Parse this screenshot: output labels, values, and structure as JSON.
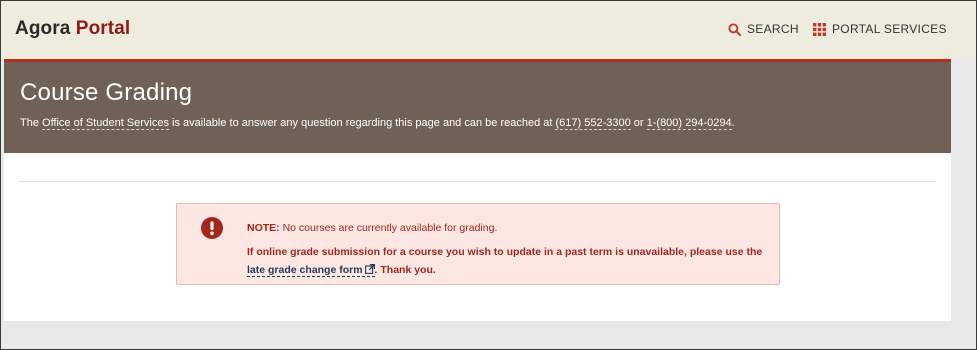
{
  "header": {
    "brand_first": "Agora",
    "brand_second": "Portal",
    "search_label": "SEARCH",
    "search_icon": "search-icon",
    "services_label": "PORTAL SERVICES",
    "services_icon": "grid-icon"
  },
  "banner": {
    "title": "Course Grading",
    "text_prefix": "The ",
    "office_link": "Office of Student Services",
    "text_middle": " is available to answer any question regarding this page and can be reached at ",
    "phone1": "(617) 552-3300",
    "text_or": " or ",
    "phone2": "1-(800) 294-0294",
    "text_end": "."
  },
  "alert": {
    "icon": "exclamation-circle-icon",
    "note_label": "NOTE:",
    "note_text": " No courses are currently available for grading.",
    "line2_text": "If online grade submission for a course you wish to update in a past term is unavailable, please use the ",
    "link_label": "late grade change form",
    "link_icon": "external-link-icon",
    "line2_end": ". Thank you."
  },
  "colors": {
    "brand_accent": "#8e1b14",
    "banner_bg": "#6f6158",
    "banner_border": "#b3301a",
    "alert_bg": "#fde7e2",
    "alert_text": "#a3261c",
    "topbar_bg": "#eeecdf"
  }
}
